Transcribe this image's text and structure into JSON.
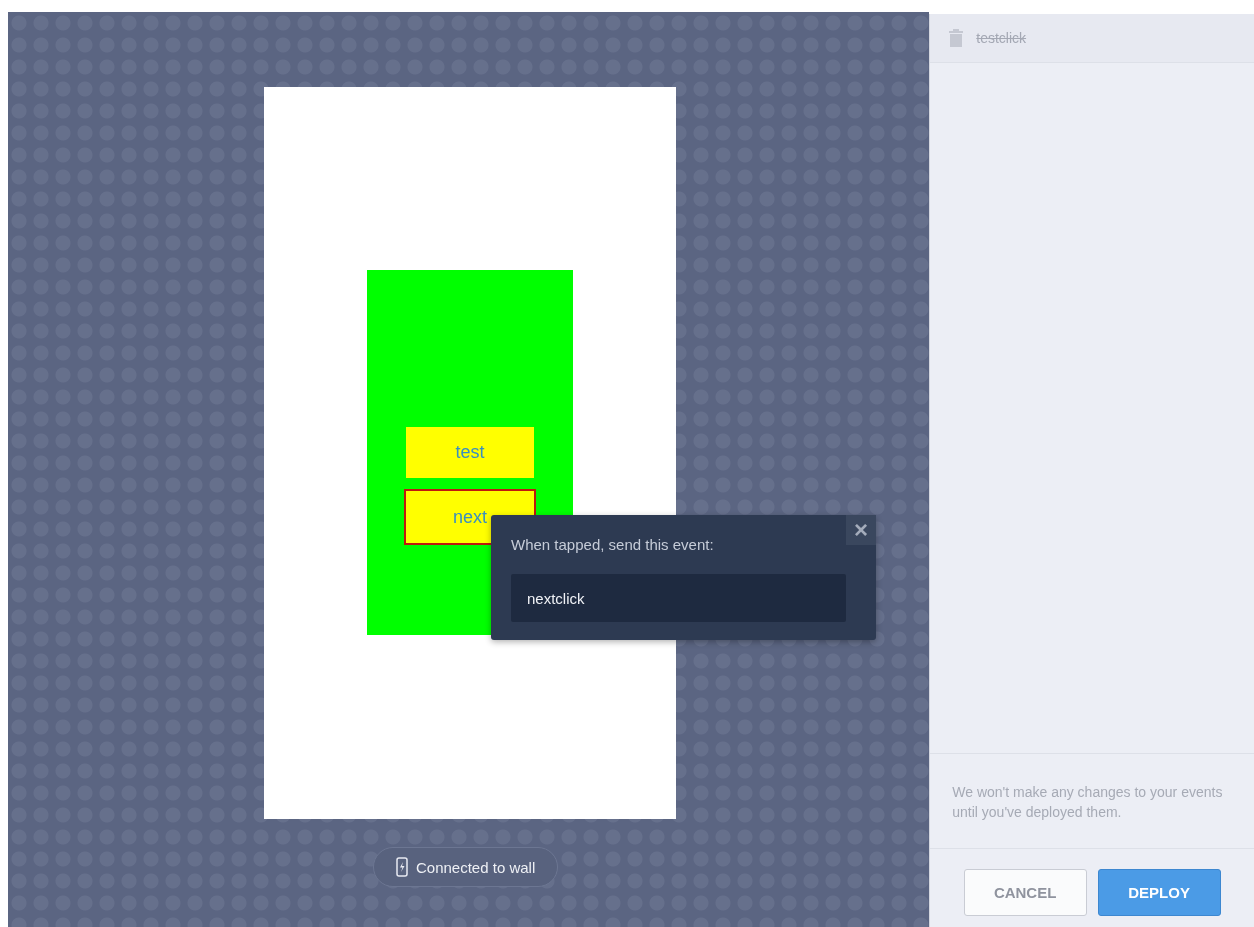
{
  "canvas": {
    "buttons": [
      {
        "label": "test",
        "selected": false
      },
      {
        "label": "next",
        "selected": true
      }
    ],
    "popover": {
      "label": "When tapped, send this event:",
      "close": "×",
      "value": "nextclick"
    },
    "status": "Connected to wall"
  },
  "events": [
    {
      "name": "testclick",
      "deleted": true
    }
  ],
  "notice": "We won't make any changes to your events until you've deployed them.",
  "actions": [
    {
      "label": "CANCEL",
      "kind": "secondary"
    },
    {
      "label": "DEPLOY",
      "kind": "primary"
    }
  ]
}
